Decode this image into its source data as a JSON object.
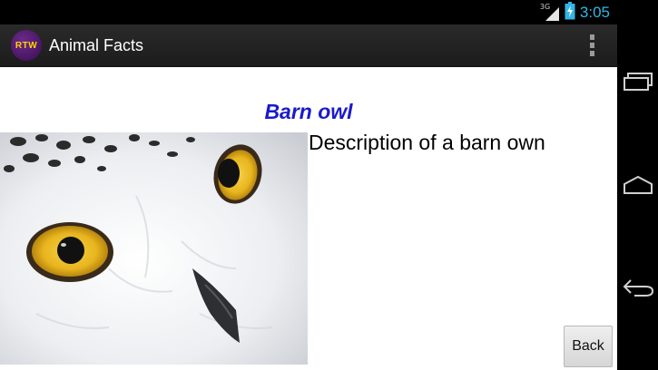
{
  "status_bar": {
    "network_type": "3G",
    "time": "3:05",
    "accent_color": "#33b5e5",
    "icons": [
      "signal-icon",
      "battery-charging-icon"
    ]
  },
  "action_bar": {
    "logo_text": "RTW",
    "title": "Animal Facts",
    "menu_icon": "overflow-menu-icon"
  },
  "content": {
    "animal_name": "Barn owl",
    "animal_name_color": "#1a1acc",
    "description": "Description of a barn own",
    "image_subject": "owl-face",
    "back_label": "Back"
  },
  "nav_bar": {
    "icons": [
      "recent-apps-icon",
      "home-icon",
      "back-icon"
    ]
  }
}
